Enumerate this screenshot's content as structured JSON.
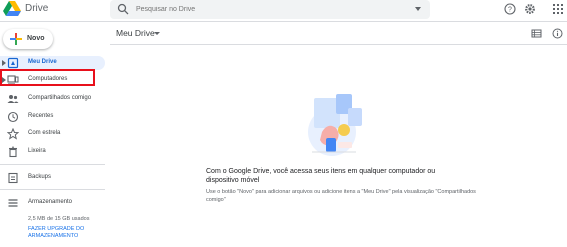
{
  "app": {
    "title": "Drive"
  },
  "search": {
    "placeholder": "Pesquisar no Drive"
  },
  "header_icons": [
    "help-icon",
    "settings-icon",
    "apps-grid-icon"
  ],
  "new_button": {
    "label": "Novo"
  },
  "sidebar": {
    "items": [
      {
        "label": "Meu Drive",
        "icon": "drive-icon",
        "active": true,
        "expandable": true
      },
      {
        "label": "Computadores",
        "icon": "computer-icon",
        "active": false,
        "expandable": true
      },
      {
        "label": "Compartilhados comigo",
        "icon": "shared-people-icon",
        "active": false
      },
      {
        "label": "Recentes",
        "icon": "clock-icon",
        "active": false
      },
      {
        "label": "Com estrela",
        "icon": "star-icon",
        "active": false
      },
      {
        "label": "Lixeira",
        "icon": "trash-icon",
        "active": false
      },
      {
        "label": "Backups",
        "icon": "backup-icon",
        "active": false
      },
      {
        "label": "Armazenamento",
        "icon": "storage-icon",
        "active": false
      }
    ],
    "storage_used": "2,5 MB de 15 GB usados",
    "upgrade_link": "FAZER UPGRADE DO ARMAZENAMENTO"
  },
  "main": {
    "title": "Meu Drive",
    "empty_title": "Com o Google Drive, você acessa seus itens em qualquer computador ou dispositivo móvel",
    "empty_desc": "Use o botão \"Novo\" para adicionar arquivos ou adicione itens a \"Meu Drive\" pela visualização \"Compartilhados comigo\""
  },
  "colors": {
    "accent": "#1a73e8",
    "active_bg": "#e8f0fe",
    "highlight": "#e8101b"
  }
}
